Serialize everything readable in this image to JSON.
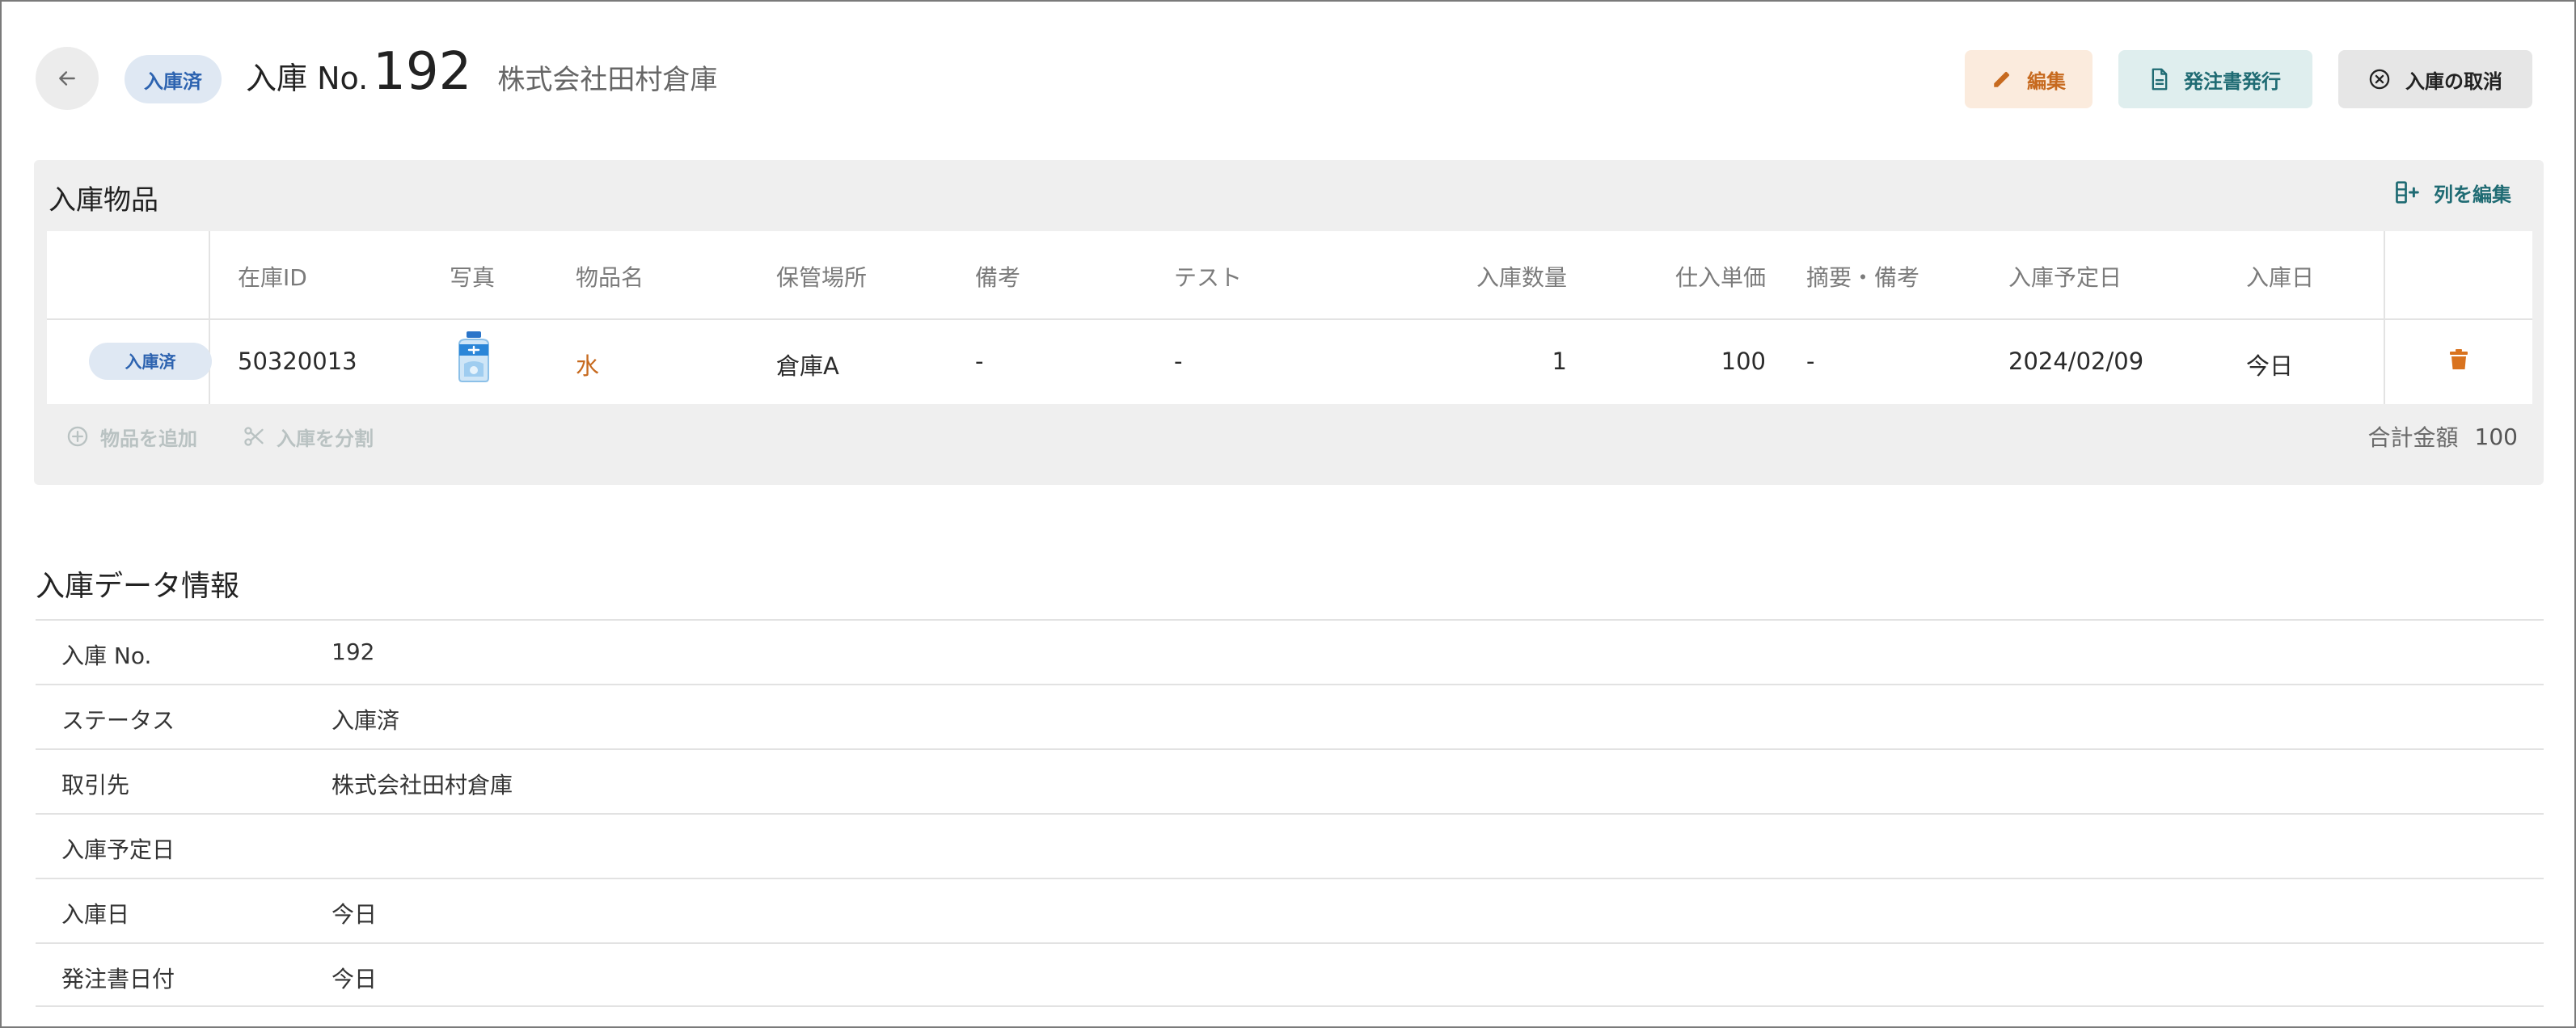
{
  "header": {
    "status": "入庫済",
    "title_prefix": "入庫 No.",
    "title_number": "192",
    "supplier": "株式会社田村倉庫",
    "buttons": {
      "edit": "編集",
      "issue_order": "発注書発行",
      "cancel_receipt": "入庫の取消"
    }
  },
  "items_card": {
    "title": "入庫物品",
    "edit_columns_label": "列を編集",
    "columns": {
      "stock_id": "在庫ID",
      "photo": "写真",
      "item_name": "物品名",
      "location": "保管場所",
      "remarks": "備考",
      "test": "テスト",
      "quantity": "入庫数量",
      "unit_price": "仕入単価",
      "summary_note": "摘要・備考",
      "scheduled_date": "入庫予定日",
      "received_date": "入庫日"
    },
    "rows": [
      {
        "status": "入庫済",
        "stock_id": "50320013",
        "photo_icon": "water-bottle-icon",
        "item_name": "水",
        "location": "倉庫A",
        "remarks": "-",
        "test": "-",
        "quantity": "1",
        "unit_price": "100",
        "summary_note": "-",
        "scheduled_date": "2024/02/09",
        "received_date": "今日"
      }
    ],
    "footer": {
      "add_item": "物品を追加",
      "split_receipt": "入庫を分割",
      "total_label": "合計金額",
      "total_value": "100"
    }
  },
  "info_section": {
    "title": "入庫データ情報",
    "rows": [
      {
        "label": "入庫 No.",
        "value": "192"
      },
      {
        "label": "ステータス",
        "value": "入庫済"
      },
      {
        "label": "取引先",
        "value": "株式会社田村倉庫"
      },
      {
        "label": "入庫予定日",
        "value": ""
      },
      {
        "label": "入庫日",
        "value": "今日"
      },
      {
        "label": "発注書日付",
        "value": "今日"
      }
    ]
  },
  "colors": {
    "accent_orange": "#c76a1f",
    "accent_teal": "#1f6b73",
    "status_blue": "#2d63b0",
    "trash_orange": "#d9731f"
  }
}
